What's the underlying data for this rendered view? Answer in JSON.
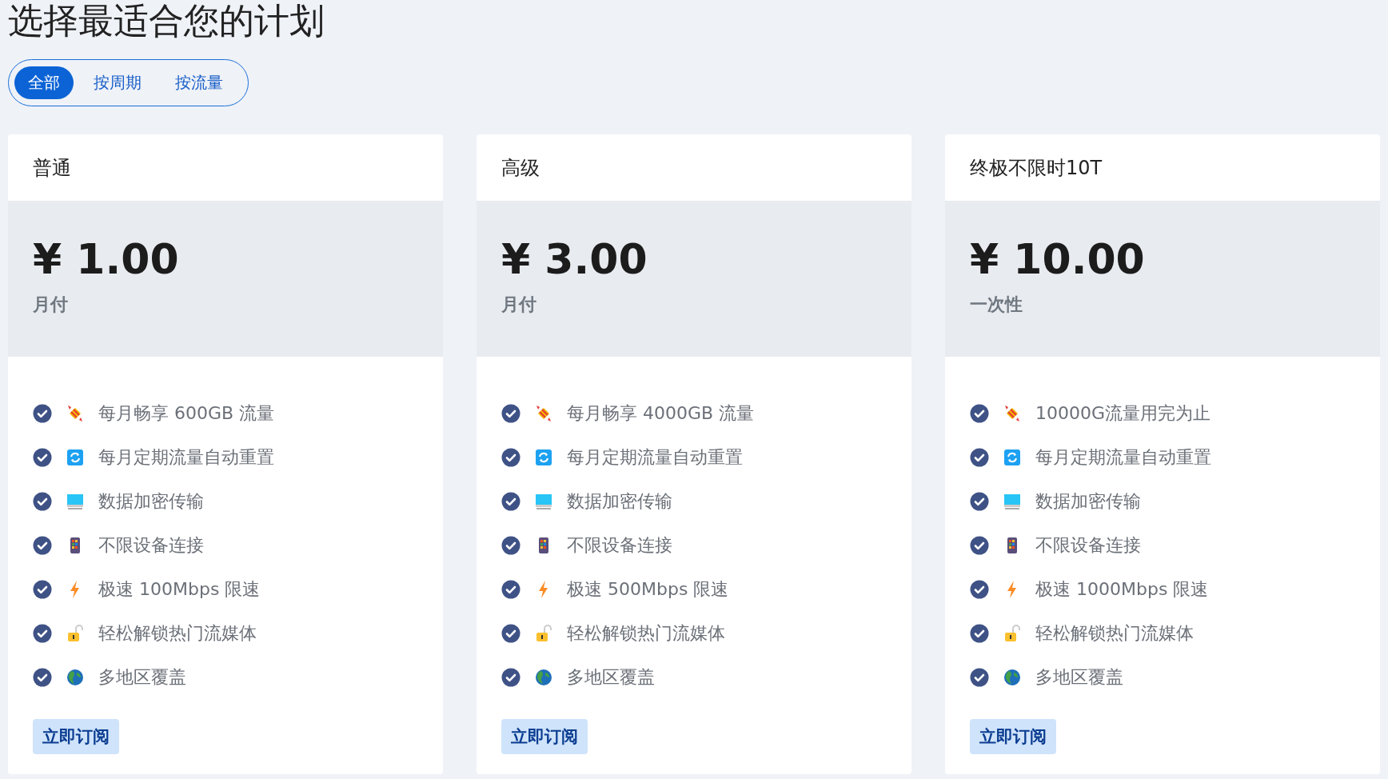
{
  "title": "选择最适合您的计划",
  "tabs": [
    {
      "label": "全部",
      "selected": true
    },
    {
      "label": "按周期",
      "selected": false
    },
    {
      "label": "按流量",
      "selected": false
    }
  ],
  "plans": [
    {
      "name": "普通",
      "price": "¥ 1.00",
      "period": "月付",
      "features": [
        {
          "kind": "candy",
          "text": "每月畅享 600GB 流量"
        },
        {
          "kind": "refresh",
          "text": "每月定期流量自动重置"
        },
        {
          "kind": "monitor",
          "text": "数据加密传输"
        },
        {
          "kind": "device",
          "text": "不限设备连接"
        },
        {
          "kind": "bolt",
          "text": "极速 100Mbps 限速"
        },
        {
          "kind": "unlock",
          "text": "轻松解锁热门流媒体"
        },
        {
          "kind": "globe",
          "text": "多地区覆盖"
        }
      ],
      "button": "立即订阅"
    },
    {
      "name": "高级",
      "price": "¥ 3.00",
      "period": "月付",
      "features": [
        {
          "kind": "candy",
          "text": "每月畅享 4000GB 流量"
        },
        {
          "kind": "refresh",
          "text": "每月定期流量自动重置"
        },
        {
          "kind": "monitor",
          "text": "数据加密传输"
        },
        {
          "kind": "device",
          "text": "不限设备连接"
        },
        {
          "kind": "bolt",
          "text": "极速 500Mbps 限速"
        },
        {
          "kind": "unlock",
          "text": "轻松解锁热门流媒体"
        },
        {
          "kind": "globe",
          "text": "多地区覆盖"
        }
      ],
      "button": "立即订阅"
    },
    {
      "name": "终极不限时10T",
      "price": "¥ 10.00",
      "period": "一次性",
      "features": [
        {
          "kind": "candy",
          "text": "10000G流量用完为止"
        },
        {
          "kind": "refresh",
          "text": "每月定期流量自动重置"
        },
        {
          "kind": "monitor",
          "text": "数据加密传输"
        },
        {
          "kind": "device",
          "text": "不限设备连接"
        },
        {
          "kind": "bolt",
          "text": "极速 1000Mbps 限速"
        },
        {
          "kind": "unlock",
          "text": "轻松解锁热门流媒体"
        },
        {
          "kind": "globe",
          "text": "多地区覆盖"
        }
      ],
      "button": "立即订阅"
    }
  ]
}
